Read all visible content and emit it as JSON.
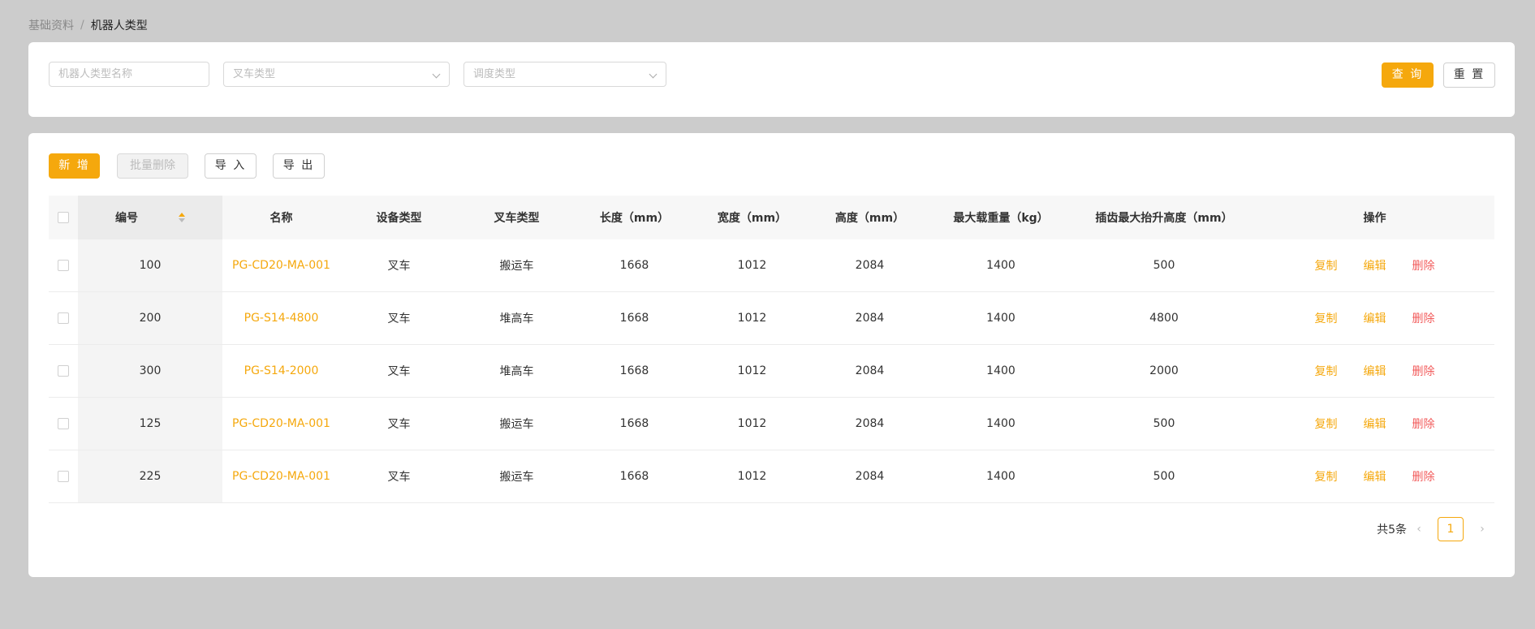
{
  "breadcrumb": {
    "parent": "基础资料",
    "separator": "/",
    "current": "机器人类型"
  },
  "search": {
    "name_placeholder": "机器人类型名称",
    "forklift_type_placeholder": "叉车类型",
    "dispatch_type_placeholder": "调度类型",
    "query_label": "查 询",
    "reset_label": "重 置"
  },
  "toolbar": {
    "add_label": "新 增",
    "batch_delete_label": "批量删除",
    "import_label": "导 入",
    "export_label": "导 出"
  },
  "table": {
    "columns": {
      "id": "编号",
      "name": "名称",
      "device_type": "设备类型",
      "forklift_type": "叉车类型",
      "length": "长度（mm）",
      "width": "宽度（mm）",
      "height": "高度（mm）",
      "max_load": "最大载重量（kg）",
      "max_lift": "插齿最大抬升高度（mm）",
      "actions": "操作"
    },
    "actions": {
      "copy": "复制",
      "edit": "编辑",
      "delete": "删除"
    },
    "rows": [
      {
        "id": "100",
        "name": "PG-CD20-MA-001",
        "device_type": "叉车",
        "forklift_type": "搬运车",
        "length": "1668",
        "width": "1012",
        "height": "2084",
        "max_load": "1400",
        "max_lift": "500"
      },
      {
        "id": "200",
        "name": "PG-S14-4800",
        "device_type": "叉车",
        "forklift_type": "堆高车",
        "length": "1668",
        "width": "1012",
        "height": "2084",
        "max_load": "1400",
        "max_lift": "4800"
      },
      {
        "id": "300",
        "name": "PG-S14-2000",
        "device_type": "叉车",
        "forklift_type": "堆高车",
        "length": "1668",
        "width": "1012",
        "height": "2084",
        "max_load": "1400",
        "max_lift": "2000"
      },
      {
        "id": "125",
        "name": "PG-CD20-MA-001",
        "device_type": "叉车",
        "forklift_type": "搬运车",
        "length": "1668",
        "width": "1012",
        "height": "2084",
        "max_load": "1400",
        "max_lift": "500"
      },
      {
        "id": "225",
        "name": "PG-CD20-MA-001",
        "device_type": "叉车",
        "forklift_type": "搬运车",
        "length": "1668",
        "width": "1012",
        "height": "2084",
        "max_load": "1400",
        "max_lift": "500"
      }
    ]
  },
  "pagination": {
    "total_label": "共5条",
    "current_page": "1"
  },
  "colors": {
    "primary": "#f5a80d",
    "danger": "#f25c5c",
    "background": "#cccccc"
  }
}
